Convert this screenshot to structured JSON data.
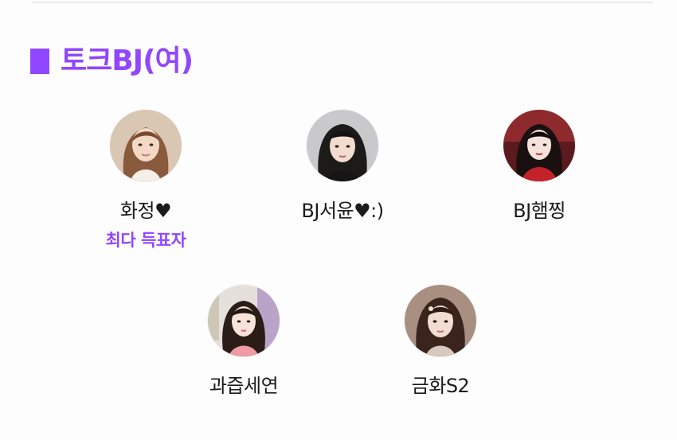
{
  "section": {
    "title": "토크BJ(여)",
    "accent_color": "#9146ff"
  },
  "profiles": [
    {
      "name": "화정♥",
      "badge": "최다 득표자",
      "icon": "avatar-photo"
    },
    {
      "name": "BJ서윤♥:)",
      "icon": "avatar-photo"
    },
    {
      "name": "BJ햄찡",
      "icon": "avatar-photo"
    },
    {
      "name": "과즙세연",
      "icon": "avatar-photo"
    },
    {
      "name": "금화S2",
      "icon": "avatar-photo"
    }
  ]
}
